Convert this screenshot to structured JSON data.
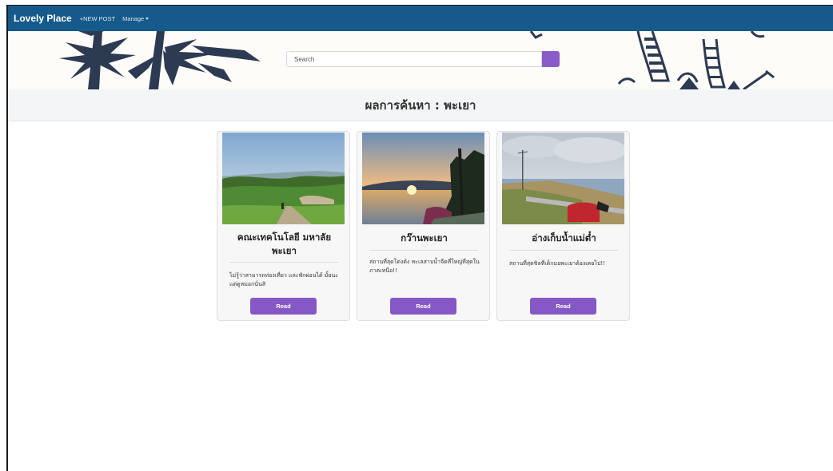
{
  "navbar": {
    "brand": "Lovely Place",
    "links": [
      "+NEW POST",
      "Manage"
    ]
  },
  "search": {
    "placeholder": "Search",
    "value": "",
    "icon": "search-icon"
  },
  "results": {
    "heading": "ผลการค้นหา : พะเยา"
  },
  "cards": [
    {
      "title": "คณะเทคโนโลยี มหาลัย พะเยา",
      "description": "ไม่รู้ว่าสามารถท่องเที่ยว และพักผ่อนได้ มั้ยนะ แต่ดูหมอกนั่นสิ",
      "button": "Read"
    },
    {
      "title": "กว๊านพะเยา",
      "description": "สถานที่สุดโด่งดัง ทะเลสาบน้ำจืดที่ใหญ่ที่สุดในภาคเหนือ!!",
      "button": "Read"
    },
    {
      "title": "อ่างเก็บน้ำแม่ต๋ำ",
      "description": "สถานที่สุดชิลที่เด็กมอพะเยาต้องเคยไป!!",
      "button": "Read"
    }
  ],
  "colors": {
    "navbar": "#155a8a",
    "accent": "#8558c6",
    "palm": "#2c3a52"
  }
}
